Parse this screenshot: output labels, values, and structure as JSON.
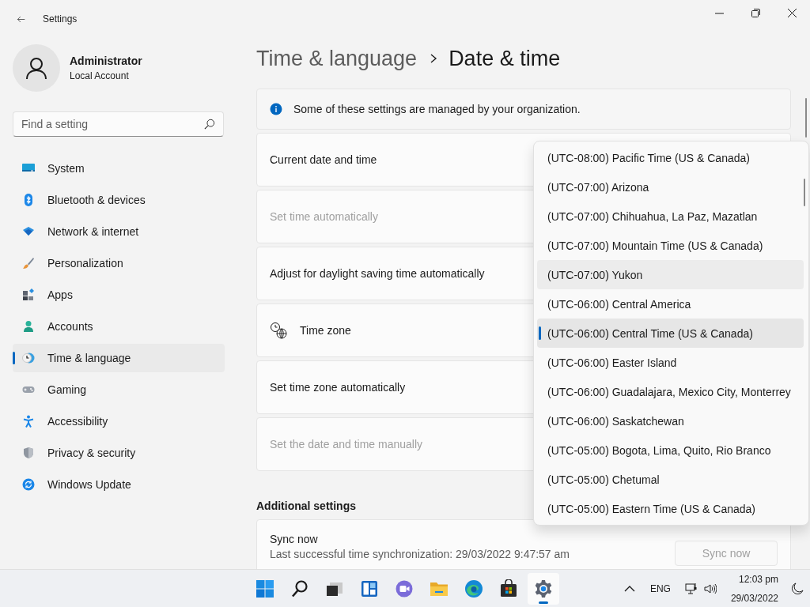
{
  "window": {
    "title": "Settings"
  },
  "user": {
    "name": "Administrator",
    "account": "Local Account"
  },
  "search": {
    "placeholder": "Find a setting"
  },
  "nav": [
    {
      "label": "System",
      "selected": false
    },
    {
      "label": "Bluetooth & devices",
      "selected": false
    },
    {
      "label": "Network & internet",
      "selected": false
    },
    {
      "label": "Personalization",
      "selected": false
    },
    {
      "label": "Apps",
      "selected": false
    },
    {
      "label": "Accounts",
      "selected": false
    },
    {
      "label": "Time & language",
      "selected": true
    },
    {
      "label": "Gaming",
      "selected": false
    },
    {
      "label": "Accessibility",
      "selected": false
    },
    {
      "label": "Privacy & security",
      "selected": false
    },
    {
      "label": "Windows Update",
      "selected": false
    }
  ],
  "breadcrumb": [
    {
      "label": "Time & language",
      "current": false
    },
    {
      "label": "Date & time",
      "current": true
    }
  ],
  "notice": "Some of these settings are managed by your organization.",
  "settings": [
    {
      "label": "Current date and time",
      "disabled": false,
      "kind": "plain"
    },
    {
      "label": "Set time automatically",
      "disabled": true,
      "kind": "plain"
    },
    {
      "label": "Adjust for daylight saving time automatically",
      "disabled": false,
      "kind": "plain"
    },
    {
      "label": "Time zone",
      "disabled": false,
      "kind": "icon"
    },
    {
      "label": "Set time zone automatically",
      "disabled": false,
      "kind": "plain"
    },
    {
      "label": "Set the date and time manually",
      "disabled": true,
      "kind": "plain"
    }
  ],
  "additional": {
    "heading": "Additional settings",
    "title": "Sync now",
    "detail": "Last successful time synchronization: 29/03/2022 9:47:57 am",
    "button": {
      "label": "Sync now",
      "disabled": true
    }
  },
  "timezone_list": [
    {
      "label": "(UTC-08:00) Pacific Time (US & Canada)",
      "selected": false,
      "hovered": false
    },
    {
      "label": "(UTC-07:00) Arizona",
      "selected": false,
      "hovered": false
    },
    {
      "label": "(UTC-07:00) Chihuahua, La Paz, Mazatlan",
      "selected": false,
      "hovered": false
    },
    {
      "label": "(UTC-07:00) Mountain Time (US & Canada)",
      "selected": false,
      "hovered": false
    },
    {
      "label": "(UTC-07:00) Yukon",
      "selected": false,
      "hovered": true
    },
    {
      "label": "(UTC-06:00) Central America",
      "selected": false,
      "hovered": false
    },
    {
      "label": "(UTC-06:00) Central Time (US & Canada)",
      "selected": true,
      "hovered": false
    },
    {
      "label": "(UTC-06:00) Easter Island",
      "selected": false,
      "hovered": false
    },
    {
      "label": "(UTC-06:00) Guadalajara, Mexico City, Monterrey",
      "selected": false,
      "hovered": false
    },
    {
      "label": "(UTC-06:00) Saskatchewan",
      "selected": false,
      "hovered": false
    },
    {
      "label": "(UTC-05:00) Bogota, Lima, Quito, Rio Branco",
      "selected": false,
      "hovered": false
    },
    {
      "label": "(UTC-05:00) Chetumal",
      "selected": false,
      "hovered": false
    },
    {
      "label": "(UTC-05:00) Eastern Time (US & Canada)",
      "selected": false,
      "hovered": false
    }
  ],
  "taskbar": {
    "apps": [
      {
        "active": false
      },
      {
        "active": false
      },
      {
        "active": false
      },
      {
        "active": false
      },
      {
        "active": false
      },
      {
        "active": false
      },
      {
        "active": false
      },
      {
        "active": false
      },
      {
        "active": true
      }
    ],
    "language": "ENG",
    "time": "12:03 pm",
    "date": "29/03/2022"
  }
}
